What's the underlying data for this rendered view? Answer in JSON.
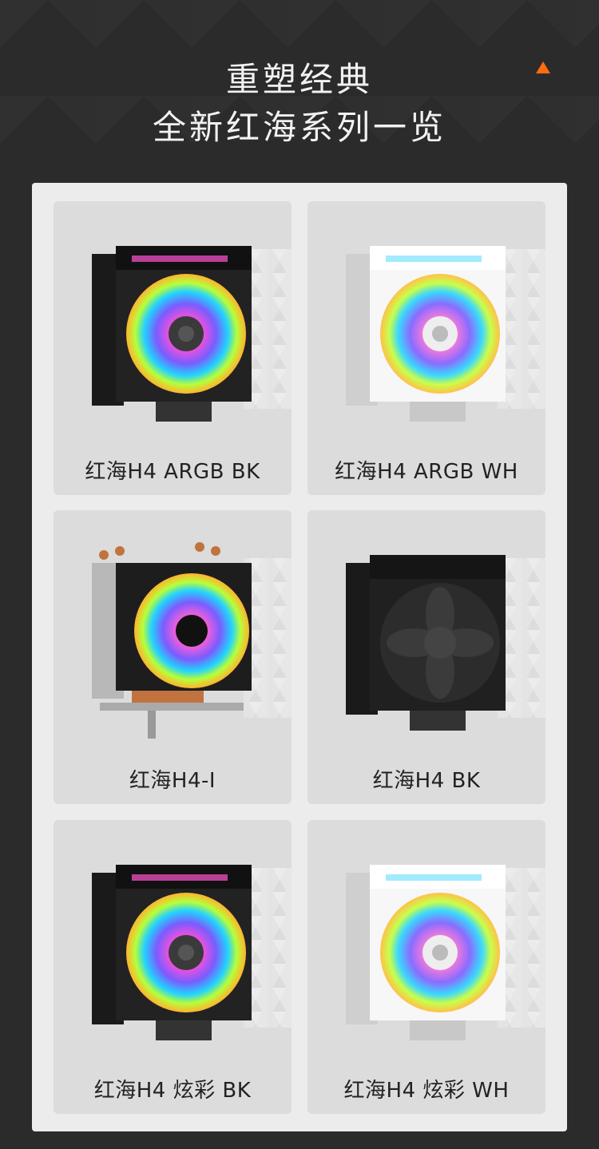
{
  "header": {
    "title_line1": "重塑经典",
    "title_line2": "全新红海系列一览",
    "arrow_color": "#ff6a13"
  },
  "products": [
    {
      "label": "红海H4 ARGB BK",
      "variant": "argb",
      "finish": "black"
    },
    {
      "label": "红海H4 ARGB WH",
      "variant": "argb",
      "finish": "white"
    },
    {
      "label": "红海H4-I",
      "variant": "intel-copper",
      "finish": "black"
    },
    {
      "label": "红海H4 BK",
      "variant": "plain",
      "finish": "black"
    },
    {
      "label": "红海H4 炫彩 BK",
      "variant": "rgb",
      "finish": "black"
    },
    {
      "label": "红海H4 炫彩 WH",
      "variant": "rgb",
      "finish": "white"
    }
  ],
  "icons": {
    "scroll_top": "arrow-up-icon",
    "product_image": "cpu-cooler-icon"
  }
}
